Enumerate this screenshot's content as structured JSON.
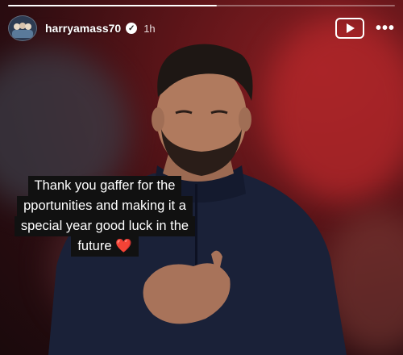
{
  "story": {
    "progress": 0.54,
    "username": "harryamass70",
    "time": "1h",
    "caption_lines": [
      "Thank you gaffer for the",
      "pportunities and making it a",
      "special year good luck in the",
      "future"
    ],
    "caption_emoji": "❤️"
  },
  "icons": {
    "verified": "verified-badge-icon",
    "play": "play-icon",
    "more": "more-options-icon"
  }
}
